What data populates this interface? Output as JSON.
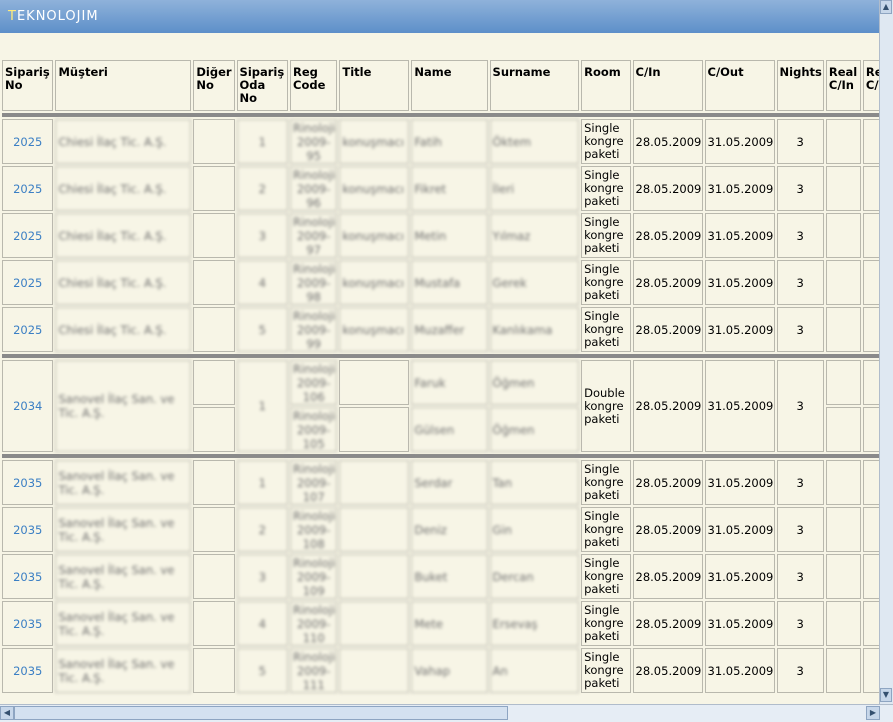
{
  "app": {
    "logo_prefix": "T",
    "logo_rest": "EKNOLOJIM"
  },
  "columns": [
    "Sipariş No",
    "Müşteri",
    "Diğer No",
    "Sipariş Oda No",
    "Reg Code",
    "Title",
    "Name",
    "Surname",
    "Room",
    "C/In",
    "C/Out",
    "Nights",
    "Real C/In",
    "Real C/Out"
  ],
  "rows": [
    {
      "siparis": "2025",
      "musteri": "Chiesi İlaç Tic. A.Ş.",
      "oda": "1",
      "reg": "Rinoloji-2009-95",
      "title": "konuşmacı",
      "name": "Fatih",
      "surname": "Öktem",
      "room": "Single kongre paketi",
      "cin": "28.05.2009",
      "cout": "31.05.2009",
      "nights": "3"
    },
    {
      "siparis": "2025",
      "musteri": "Chiesi İlaç Tic. A.Ş.",
      "oda": "2",
      "reg": "Rinoloji-2009-96",
      "title": "konuşmacı",
      "name": "Fikret",
      "surname": "İleri",
      "room": "Single kongre paketi",
      "cin": "28.05.2009",
      "cout": "31.05.2009",
      "nights": "3"
    },
    {
      "siparis": "2025",
      "musteri": "Chiesi İlaç Tic. A.Ş.",
      "oda": "3",
      "reg": "Rinoloji-2009-97",
      "title": "konuşmacı",
      "name": "Metin",
      "surname": "Yılmaz",
      "room": "Single kongre paketi",
      "cin": "28.05.2009",
      "cout": "31.05.2009",
      "nights": "3"
    },
    {
      "siparis": "2025",
      "musteri": "Chiesi İlaç Tic. A.Ş.",
      "oda": "4",
      "reg": "Rinoloji-2009-98",
      "title": "konuşmacı",
      "name": "Mustafa",
      "surname": "Gerek",
      "room": "Single kongre paketi",
      "cin": "28.05.2009",
      "cout": "31.05.2009",
      "nights": "3"
    },
    {
      "siparis": "2025",
      "musteri": "Chiesi İlaç Tic. A.Ş.",
      "oda": "5",
      "reg": "Rinoloji-2009-99",
      "title": "konuşmacı",
      "name": "Muzaffer",
      "surname": "Kanlıkama",
      "room": "Single kongre paketi",
      "cin": "28.05.2009",
      "cout": "31.05.2009",
      "nights": "3"
    }
  ],
  "group2": {
    "siparis": "2034",
    "musteri": "Sanovel İlaç San. ve Tic. A.Ş.",
    "oda": "1",
    "room": "Double kongre paketi",
    "cin": "28.05.2009",
    "cout": "31.05.2009",
    "nights": "3",
    "guests": [
      {
        "reg": "Rinoloji-2009-106",
        "name": "Faruk",
        "surname": "Öğmen"
      },
      {
        "reg": "Rinoloji-2009-105",
        "name": "Gülsen",
        "surname": "Öğmen"
      }
    ]
  },
  "rows3": [
    {
      "siparis": "2035",
      "musteri": "Sanovel İlaç San. ve Tic. A.Ş.",
      "oda": "1",
      "reg": "Rinoloji-2009-107",
      "name": "Serdar",
      "surname": "Tan",
      "room": "Single kongre paketi",
      "cin": "28.05.2009",
      "cout": "31.05.2009",
      "nights": "3"
    },
    {
      "siparis": "2035",
      "musteri": "Sanovel İlaç San. ve Tic. A.Ş.",
      "oda": "2",
      "reg": "Rinoloji-2009-108",
      "name": "Deniz",
      "surname": "Gin",
      "room": "Single kongre paketi",
      "cin": "28.05.2009",
      "cout": "31.05.2009",
      "nights": "3"
    },
    {
      "siparis": "2035",
      "musteri": "Sanovel İlaç San. ve Tic. A.Ş.",
      "oda": "3",
      "reg": "Rinoloji-2009-109",
      "name": "Buket",
      "surname": "Dercan",
      "room": "Single kongre paketi",
      "cin": "28.05.2009",
      "cout": "31.05.2009",
      "nights": "3"
    },
    {
      "siparis": "2035",
      "musteri": "Sanovel İlaç San. ve Tic. A.Ş.",
      "oda": "4",
      "reg": "Rinoloji-2009-110",
      "name": "Mete",
      "surname": "Ersevaş",
      "room": "Single kongre paketi",
      "cin": "28.05.2009",
      "cout": "31.05.2009",
      "nights": "3"
    },
    {
      "siparis": "2035",
      "musteri": "Sanovel İlaç San. ve Tic. A.Ş.",
      "oda": "5",
      "reg": "Rinoloji-2009-111",
      "name": "Vahap",
      "surname": "An",
      "room": "Single kongre paketi",
      "cin": "28.05.2009",
      "cout": "31.05.2009",
      "nights": "3"
    }
  ],
  "scroll": {
    "up": "▲",
    "down": "▼",
    "left": "◀",
    "right": "▶"
  },
  "colors": {
    "header_bg": "#5d8fc9",
    "page_bg": "#f7f5e6",
    "link": "#3b7fc4",
    "separator": "#8a8a8a"
  }
}
